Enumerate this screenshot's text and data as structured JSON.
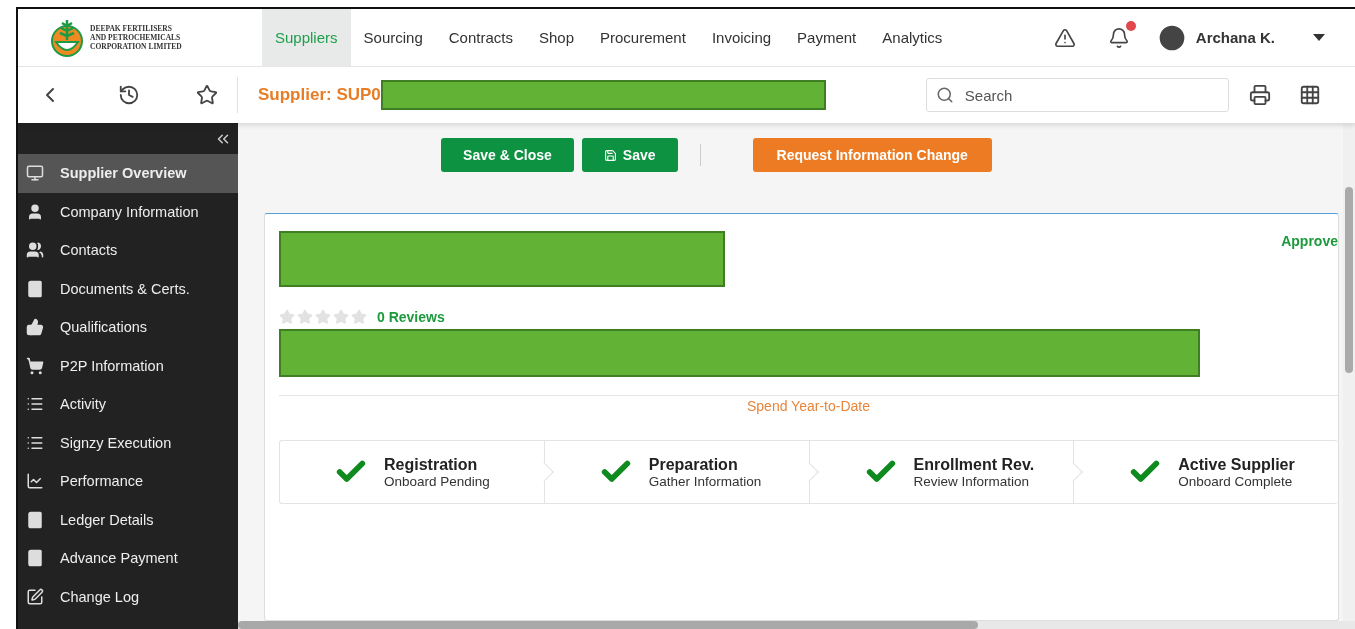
{
  "brand": {
    "lines": [
      "DEEPAK FERTILISERS",
      "AND PETROCHEMICALS",
      "CORPORATION LIMITED"
    ]
  },
  "nav": [
    {
      "label": "Suppliers",
      "selected": true
    },
    {
      "label": "Sourcing",
      "selected": false
    },
    {
      "label": "Contracts",
      "selected": false
    },
    {
      "label": "Shop",
      "selected": false
    },
    {
      "label": "Procurement",
      "selected": false
    },
    {
      "label": "Invoicing",
      "selected": false
    },
    {
      "label": "Payment",
      "selected": false
    },
    {
      "label": "Analytics",
      "selected": false
    }
  ],
  "notifications": {
    "unread": true
  },
  "user": {
    "name": "Archana K."
  },
  "page_title": "Supplier: SUP0",
  "search": {
    "placeholder": "Search"
  },
  "sidebar": [
    {
      "label": "Supplier Overview",
      "selected": true
    },
    {
      "label": "Company Information",
      "selected": false
    },
    {
      "label": "Contacts",
      "selected": false
    },
    {
      "label": "Documents & Certs.",
      "selected": false
    },
    {
      "label": "Qualifications",
      "selected": false
    },
    {
      "label": "P2P Information",
      "selected": false
    },
    {
      "label": "Activity",
      "selected": false
    },
    {
      "label": "Signzy Execution",
      "selected": false
    },
    {
      "label": "Performance",
      "selected": false
    },
    {
      "label": "Ledger Details",
      "selected": false
    },
    {
      "label": "Advance Payment",
      "selected": false
    },
    {
      "label": "Change Log",
      "selected": false
    }
  ],
  "actions": [
    {
      "label": "Save & Close",
      "kind": "primary"
    },
    {
      "label": "Save",
      "kind": "save"
    },
    {
      "label": "Request Information Change",
      "kind": "warning"
    }
  ],
  "card": {
    "status": "Approve",
    "stars": 0,
    "reviews": "0 Reviews",
    "spend_label": "Spend Year-to-Date",
    "steps": [
      {
        "title": "Registration",
        "subtitle": "Onboard Pending",
        "done": true
      },
      {
        "title": "Preparation",
        "subtitle": "Gather Information",
        "done": true
      },
      {
        "title": "Enrollment Rev.",
        "subtitle": "Review Information",
        "done": true
      },
      {
        "title": "Active Supplier",
        "subtitle": "Onboard Complete",
        "done": true
      }
    ]
  }
}
